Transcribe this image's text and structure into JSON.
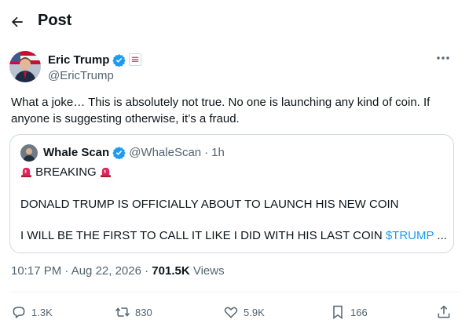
{
  "header": {
    "title": "Post"
  },
  "author": {
    "name": "Eric Trump",
    "handle": "@EricTrump"
  },
  "post": {
    "text": "What a joke… This is absolutely not true. No one is launching any kind of coin. If anyone is suggesting otherwise, it’s a fraud.",
    "timestamp": "10:17 PM · Aug 22, 2026",
    "separator": " · ",
    "views_count": "701.5K",
    "views_label": " Views"
  },
  "quote": {
    "name": "Whale Scan",
    "handle": "@WhaleScan",
    "dot": "·",
    "time": "1h",
    "breaking": "BREAKING",
    "line1": "DONALD TRUMP IS OFFICIALLY ABOUT TO LAUNCH HIS NEW COIN",
    "line2_prefix": "I WILL BE THE FIRST TO CALL IT LIKE I DID WITH HIS LAST COIN ",
    "line2_link": "$TRUMP",
    "line2_suffix": " ..."
  },
  "actions": {
    "replies": "1.3K",
    "reposts": "830",
    "likes": "5.9K",
    "bookmarks": "166"
  },
  "colors": {
    "accent": "#1d9bf0",
    "text": "#0f1419",
    "muted": "#536471",
    "border": "#cfd9de"
  },
  "icons": [
    "back-arrow-icon",
    "verified-badge-icon",
    "flag-label-icon",
    "more-icon",
    "siren-icon",
    "reply-icon",
    "repost-icon",
    "like-icon",
    "bookmark-icon",
    "share-icon"
  ]
}
